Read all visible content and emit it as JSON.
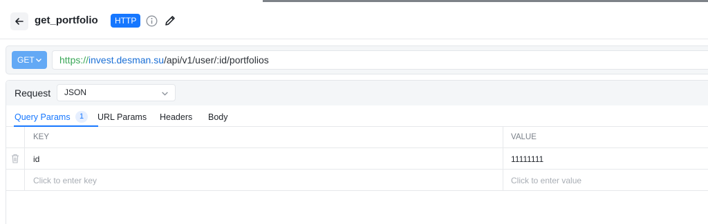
{
  "header": {
    "title": "get_portfolio",
    "badge": "HTTP"
  },
  "url_bar": {
    "method": "GET",
    "url_protocol": "https://",
    "url_host": "invest.desman.su",
    "url_path": "/api/v1/user/:id/portfolios"
  },
  "request": {
    "label": "Request",
    "body_type": "JSON",
    "tabs": [
      {
        "label": "Query Params",
        "count": "1",
        "active": true
      },
      {
        "label": "URL Params"
      },
      {
        "label": "Headers"
      },
      {
        "label": "Body"
      }
    ],
    "table": {
      "columns": [
        "KEY",
        "VALUE"
      ],
      "rows": [
        {
          "key": "id",
          "value": "11111111"
        }
      ],
      "new_row": {
        "key_placeholder": "Click to enter key",
        "value_placeholder": "Click to enter value"
      }
    }
  },
  "colors": {
    "accent": "#1677ff",
    "method_bg": "#63a9f5",
    "protocol": "#3aa757",
    "host": "#1a6fd6"
  }
}
